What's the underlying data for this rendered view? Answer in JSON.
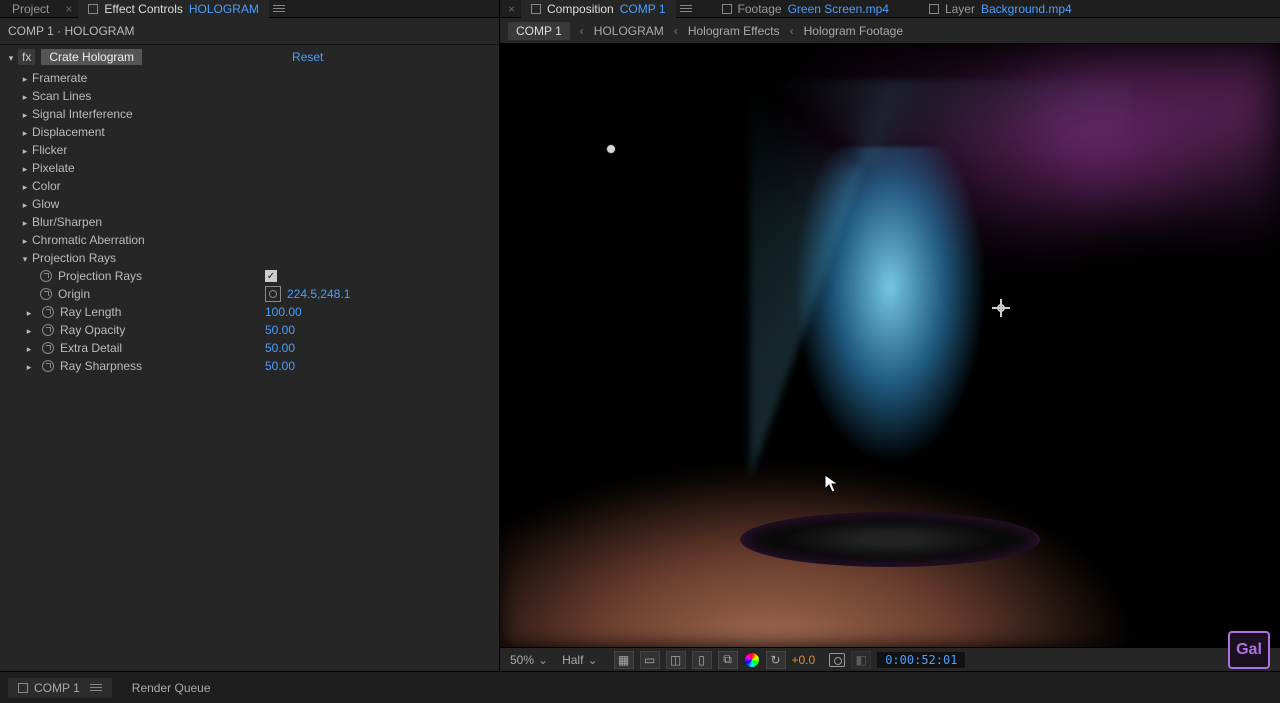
{
  "left_tabs": {
    "project": "Project",
    "effect_controls": "Effect Controls",
    "effect_target": "HOLOGRAM"
  },
  "right_tabs": {
    "composition": "Composition",
    "comp_target": "COMP 1",
    "footage": "Footage",
    "footage_target": "Green Screen.mp4",
    "layer": "Layer",
    "layer_target": "Background.mp4"
  },
  "breadcrumb": {
    "items": [
      "COMP 1",
      "HOLOGRAM",
      "Hologram Effects",
      "Hologram Footage"
    ]
  },
  "comp_title": "COMP 1 · HOLOGRAM",
  "effect": {
    "fx_badge": "fx",
    "name": "Crate Hologram",
    "reset": "Reset",
    "groups": [
      "Framerate",
      "Scan Lines",
      "Signal Interference",
      "Displacement",
      "Flicker",
      "Pixelate",
      "Color",
      "Glow",
      "Blur/Sharpen",
      "Chromatic Aberration"
    ],
    "open_group": "Projection Rays",
    "props": {
      "projection_rays": {
        "label": "Projection Rays",
        "checked": "✓"
      },
      "origin": {
        "label": "Origin",
        "value": "224.5,248.1"
      },
      "ray_length": {
        "label": "Ray Length",
        "value": "100.00"
      },
      "ray_opacity": {
        "label": "Ray Opacity",
        "value": "50.00"
      },
      "extra_detail": {
        "label": "Extra Detail",
        "value": "50.00"
      },
      "ray_sharpness": {
        "label": "Ray Sharpness",
        "value": "50.00"
      }
    }
  },
  "viewer": {
    "zoom": "50%",
    "resolution": "Half",
    "exposure": "+0.0",
    "timecode": "0:00:52:01"
  },
  "bottom": {
    "comp": "COMP 1",
    "render_queue": "Render Queue"
  },
  "brand": "Gal"
}
